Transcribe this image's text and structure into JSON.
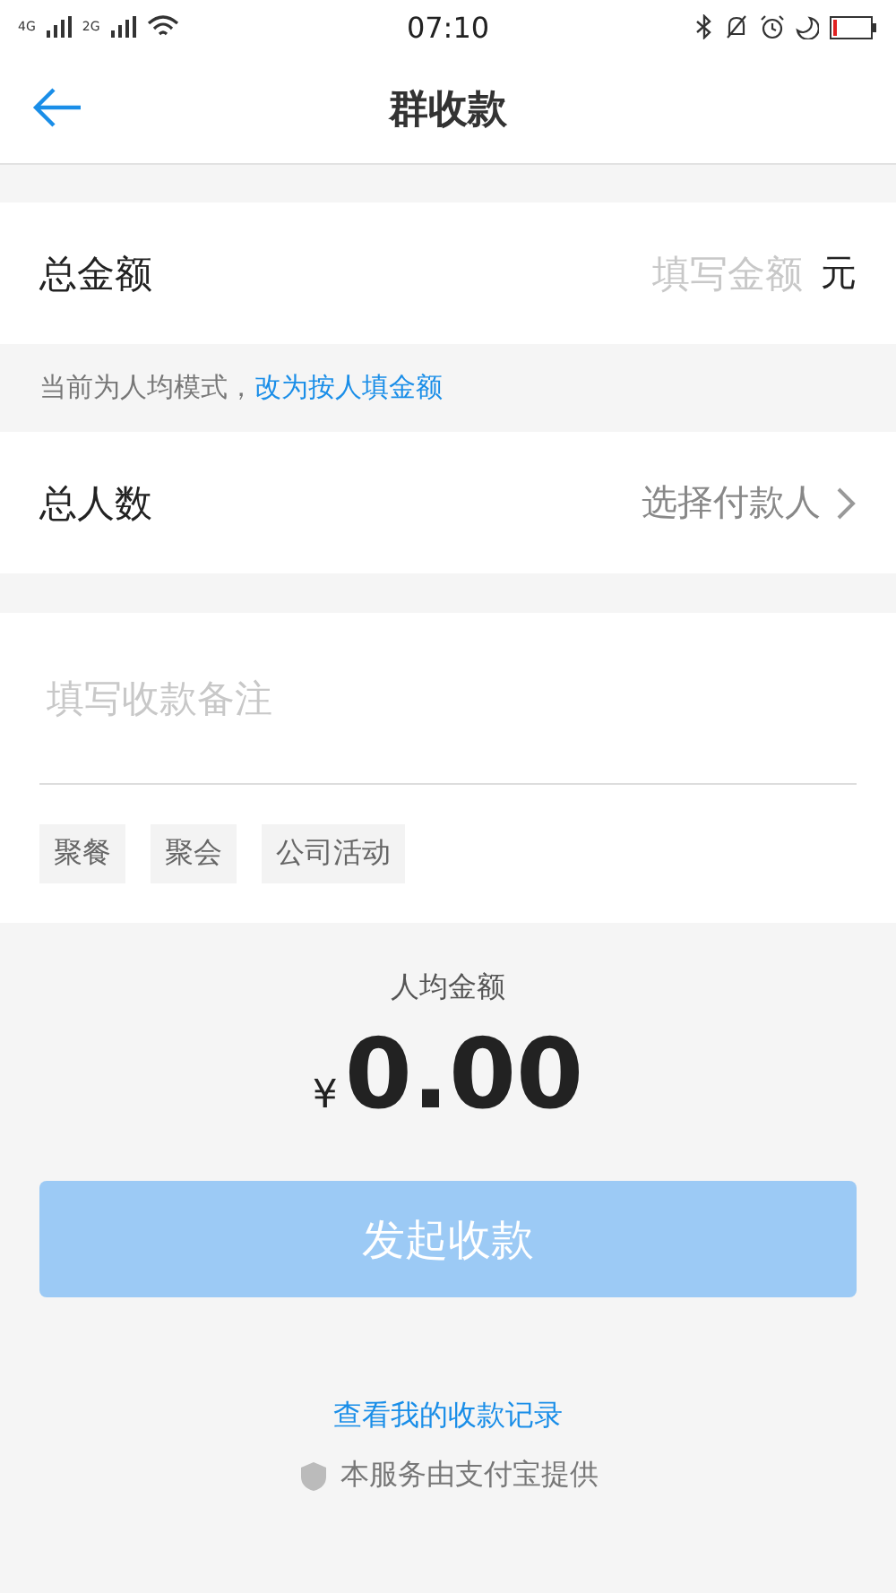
{
  "status_bar": {
    "network_1": "4G",
    "network_2": "2G",
    "time": "07:10"
  },
  "header": {
    "title": "群收款"
  },
  "total_amount": {
    "label": "总金额",
    "placeholder": "填写金额",
    "unit": "元"
  },
  "mode_hint": {
    "text": "当前为人均模式，",
    "link": "改为按人填金额"
  },
  "people": {
    "label": "总人数",
    "value": "选择付款人"
  },
  "remark": {
    "placeholder": "填写收款备注",
    "tags": [
      "聚餐",
      "聚会",
      "公司活动"
    ]
  },
  "per_person": {
    "label": "人均金额",
    "currency": "¥",
    "amount": "0.00"
  },
  "submit": {
    "label": "发起收款",
    "disabled": true
  },
  "records_link": "查看我的收款记录",
  "provider": "本服务由支付宝提供"
}
